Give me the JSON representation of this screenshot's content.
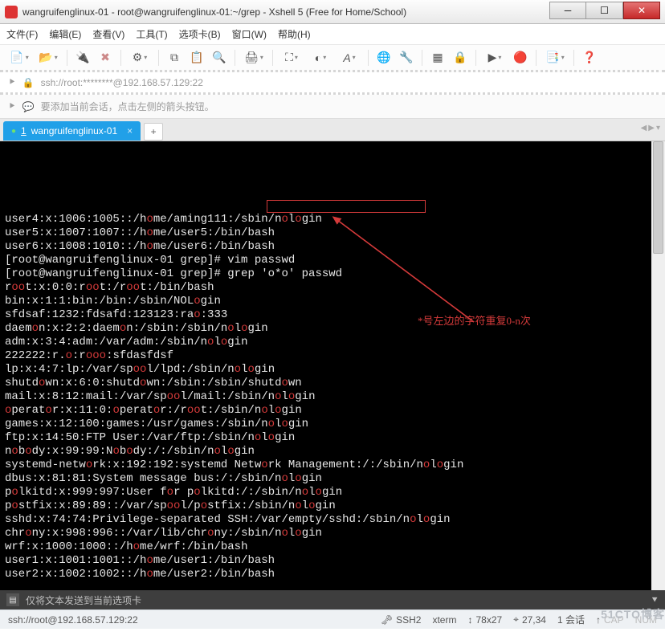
{
  "window": {
    "title": "wangruifenglinux-01 - root@wangruifenglinux-01:~/grep - Xshell 5 (Free for Home/School)"
  },
  "menu": {
    "file": "文件(F)",
    "edit": "编辑(E)",
    "view": "查看(V)",
    "tools": "工具(T)",
    "tabs": "选项卡(B)",
    "window": "窗口(W)",
    "help": "帮助(H)"
  },
  "address": {
    "text": "ssh://root:********@192.168.57.129:22"
  },
  "hint": {
    "text": "要添加当前会话，点击左侧的箭头按钮。"
  },
  "tab": {
    "index": "1",
    "label": "wangruifenglinux-01"
  },
  "highlight_box_command": "grep 'o*o' passwd",
  "annotation": "*号左边的字符重复0-n次",
  "term_lines": [
    [
      [
        "w",
        "user4:x:1006:1005::/h"
      ],
      [
        "r",
        "o"
      ],
      [
        "w",
        "me/aming111:/sbin/n"
      ],
      [
        "r",
        "o"
      ],
      [
        "w",
        "l"
      ],
      [
        "r",
        "o"
      ],
      [
        "w",
        "gin"
      ]
    ],
    [
      [
        "w",
        "user5:x:1007:1007::/h"
      ],
      [
        "r",
        "o"
      ],
      [
        "w",
        "me/user5:/bin/bash"
      ]
    ],
    [
      [
        "w",
        "user6:x:1008:1010::/h"
      ],
      [
        "r",
        "o"
      ],
      [
        "w",
        "me/user6:/bin/bash"
      ]
    ],
    [
      [
        "w",
        "[root@wangruifenglinux-01 grep]# vim passwd"
      ]
    ],
    [
      [
        "w",
        "[root@wangruifenglinux-01 grep]# grep 'o*o' passwd"
      ]
    ],
    [
      [
        "w",
        "r"
      ],
      [
        "r",
        "oo"
      ],
      [
        "w",
        "t:x:0:0:r"
      ],
      [
        "r",
        "oo"
      ],
      [
        "w",
        "t:/r"
      ],
      [
        "r",
        "oo"
      ],
      [
        "w",
        "t:/bin/bash"
      ]
    ],
    [
      [
        "w",
        "bin:x:1:1:bin:/bin:/sbin/NOL"
      ],
      [
        "r",
        "o"
      ],
      [
        "w",
        "gin"
      ]
    ],
    [
      [
        "w",
        "sfdsaf:1232:fdsafd:123123:ra"
      ],
      [
        "r",
        "o"
      ],
      [
        "w",
        ":333"
      ]
    ],
    [
      [
        "w",
        "daem"
      ],
      [
        "r",
        "o"
      ],
      [
        "w",
        "n:x:2:2:daem"
      ],
      [
        "r",
        "o"
      ],
      [
        "w",
        "n:/sbin:/sbin/n"
      ],
      [
        "r",
        "o"
      ],
      [
        "w",
        "l"
      ],
      [
        "r",
        "o"
      ],
      [
        "w",
        "gin"
      ]
    ],
    [
      [
        "w",
        "adm:x:3:4:adm:/var/adm:/sbin/n"
      ],
      [
        "r",
        "o"
      ],
      [
        "w",
        "l"
      ],
      [
        "r",
        "o"
      ],
      [
        "w",
        "gin"
      ]
    ],
    [
      [
        "w",
        "222222:r."
      ],
      [
        "r",
        "o"
      ],
      [
        "w",
        ":r"
      ],
      [
        "r",
        "ooo"
      ],
      [
        "w",
        ":sfdasfdsf"
      ]
    ],
    [
      [
        "w",
        "lp:x:4:7:lp:/var/sp"
      ],
      [
        "r",
        "oo"
      ],
      [
        "w",
        "l/lpd:/sbin/n"
      ],
      [
        "r",
        "o"
      ],
      [
        "w",
        "l"
      ],
      [
        "r",
        "o"
      ],
      [
        "w",
        "gin"
      ]
    ],
    [
      [
        "w",
        "shutd"
      ],
      [
        "r",
        "o"
      ],
      [
        "w",
        "wn:x:6:0:shutd"
      ],
      [
        "r",
        "o"
      ],
      [
        "w",
        "wn:/sbin:/sbin/shutd"
      ],
      [
        "r",
        "o"
      ],
      [
        "w",
        "wn"
      ]
    ],
    [
      [
        "w",
        "mail:x:8:12:mail:/var/sp"
      ],
      [
        "r",
        "oo"
      ],
      [
        "w",
        "l/mail:/sbin/n"
      ],
      [
        "r",
        "o"
      ],
      [
        "w",
        "l"
      ],
      [
        "r",
        "o"
      ],
      [
        "w",
        "gin"
      ]
    ],
    [
      [
        "r",
        "o"
      ],
      [
        "w",
        "perat"
      ],
      [
        "r",
        "o"
      ],
      [
        "w",
        "r:x:11:0:"
      ],
      [
        "r",
        "o"
      ],
      [
        "w",
        "perat"
      ],
      [
        "r",
        "o"
      ],
      [
        "w",
        "r:/r"
      ],
      [
        "r",
        "oo"
      ],
      [
        "w",
        "t:/sbin/n"
      ],
      [
        "r",
        "o"
      ],
      [
        "w",
        "l"
      ],
      [
        "r",
        "o"
      ],
      [
        "w",
        "gin"
      ]
    ],
    [
      [
        "w",
        "games:x:12:100:games:/usr/games:/sbin/n"
      ],
      [
        "r",
        "o"
      ],
      [
        "w",
        "l"
      ],
      [
        "r",
        "o"
      ],
      [
        "w",
        "gin"
      ]
    ],
    [
      [
        "w",
        "ftp:x:14:50:FTP User:/var/ftp:/sbin/n"
      ],
      [
        "r",
        "o"
      ],
      [
        "w",
        "l"
      ],
      [
        "r",
        "o"
      ],
      [
        "w",
        "gin"
      ]
    ],
    [
      [
        "w",
        "n"
      ],
      [
        "r",
        "o"
      ],
      [
        "w",
        "b"
      ],
      [
        "r",
        "o"
      ],
      [
        "w",
        "dy:x:99:99:N"
      ],
      [
        "r",
        "o"
      ],
      [
        "w",
        "b"
      ],
      [
        "r",
        "o"
      ],
      [
        "w",
        "dy:/:/sbin/n"
      ],
      [
        "r",
        "o"
      ],
      [
        "w",
        "l"
      ],
      [
        "r",
        "o"
      ],
      [
        "w",
        "gin"
      ]
    ],
    [
      [
        "w",
        "systemd-netw"
      ],
      [
        "r",
        "o"
      ],
      [
        "w",
        "rk:x:192:192:systemd Netw"
      ],
      [
        "r",
        "o"
      ],
      [
        "w",
        "rk Management:/:/sbin/n"
      ],
      [
        "r",
        "o"
      ],
      [
        "w",
        "l"
      ],
      [
        "r",
        "o"
      ],
      [
        "w",
        "gin"
      ]
    ],
    [
      [
        "w",
        "dbus:x:81:81:System message bus:/:/sbin/n"
      ],
      [
        "r",
        "o"
      ],
      [
        "w",
        "l"
      ],
      [
        "r",
        "o"
      ],
      [
        "w",
        "gin"
      ]
    ],
    [
      [
        "w",
        "p"
      ],
      [
        "r",
        "o"
      ],
      [
        "w",
        "lkitd:x:999:997:User f"
      ],
      [
        "r",
        "o"
      ],
      [
        "w",
        "r p"
      ],
      [
        "r",
        "o"
      ],
      [
        "w",
        "lkitd:/:/sbin/n"
      ],
      [
        "r",
        "o"
      ],
      [
        "w",
        "l"
      ],
      [
        "r",
        "o"
      ],
      [
        "w",
        "gin"
      ]
    ],
    [
      [
        "w",
        "p"
      ],
      [
        "r",
        "o"
      ],
      [
        "w",
        "stfix:x:89:89::/var/sp"
      ],
      [
        "r",
        "oo"
      ],
      [
        "w",
        "l/p"
      ],
      [
        "r",
        "o"
      ],
      [
        "w",
        "stfix:/sbin/n"
      ],
      [
        "r",
        "o"
      ],
      [
        "w",
        "l"
      ],
      [
        "r",
        "o"
      ],
      [
        "w",
        "gin"
      ]
    ],
    [
      [
        "w",
        "sshd:x:74:74:Privilege-separated SSH:/var/empty/sshd:/sbin/n"
      ],
      [
        "r",
        "o"
      ],
      [
        "w",
        "l"
      ],
      [
        "r",
        "o"
      ],
      [
        "w",
        "gin"
      ]
    ],
    [
      [
        "w",
        "chr"
      ],
      [
        "r",
        "o"
      ],
      [
        "w",
        "ny:x:998:996::/var/lib/chr"
      ],
      [
        "r",
        "o"
      ],
      [
        "w",
        "ny:/sbin/n"
      ],
      [
        "r",
        "o"
      ],
      [
        "w",
        "l"
      ],
      [
        "r",
        "o"
      ],
      [
        "w",
        "gin"
      ]
    ],
    [
      [
        "w",
        "wrf:x:1000:1000::/h"
      ],
      [
        "r",
        "o"
      ],
      [
        "w",
        "me/wrf:/bin/bash"
      ]
    ],
    [
      [
        "w",
        "user1:x:1001:1001::/h"
      ],
      [
        "r",
        "o"
      ],
      [
        "w",
        "me/user1:/bin/bash"
      ]
    ],
    [
      [
        "w",
        "user2:x:1002:1002::/h"
      ],
      [
        "r",
        "o"
      ],
      [
        "w",
        "me/user2:/bin/bash"
      ]
    ]
  ],
  "cmdstrip": {
    "text": "仅将文本发送到当前选项卡"
  },
  "status": {
    "left": "ssh://root@192.168.57.129:22",
    "ssh": "SSH2",
    "term": "xterm",
    "size": "78x27",
    "pos": "27,34",
    "sessions": "1 会话",
    "caps": "CAP",
    "num": "NUM"
  },
  "watermark": "51CTO博客"
}
